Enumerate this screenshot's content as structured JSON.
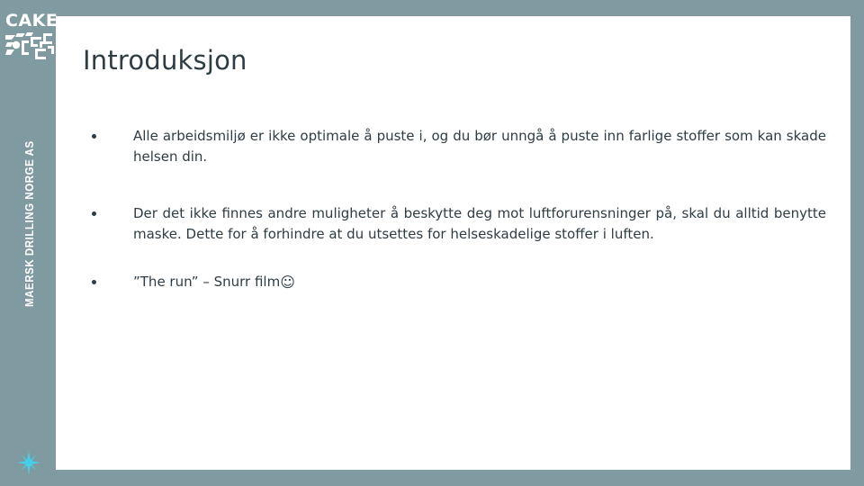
{
  "slide": {
    "title": "Introduksjon",
    "background_color": "#7f9aa0",
    "panel_color": "#ffffff",
    "text_color": "#2f3c43"
  },
  "branding": {
    "logo_word": "CAKE",
    "logo_mark_icon": "circuit-maze-icon",
    "vertical_text": "MAERSK DRILLING NORGE AS",
    "star_icon": "maersk-star-icon",
    "star_color": "#3ec8e8"
  },
  "bullets": [
    {
      "marker": "bullet-dot",
      "text": "Alle arbeidsmiljø er ikke optimale å puste i, og du bør unngå å puste inn farlige stoffer som kan skade helsen din."
    },
    {
      "marker": "bullet-dot",
      "text": "Der det ikke finnes andre muligheter å beskytte deg mot luftforurensninger på, skal du alltid benytte maske. Dette for å forhindre at du utsettes for helseskadelige stoffer i luften."
    },
    {
      "marker": "bullet-dot",
      "text": "”The run” – Snurr film",
      "trailing_glyph": "☺"
    }
  ]
}
